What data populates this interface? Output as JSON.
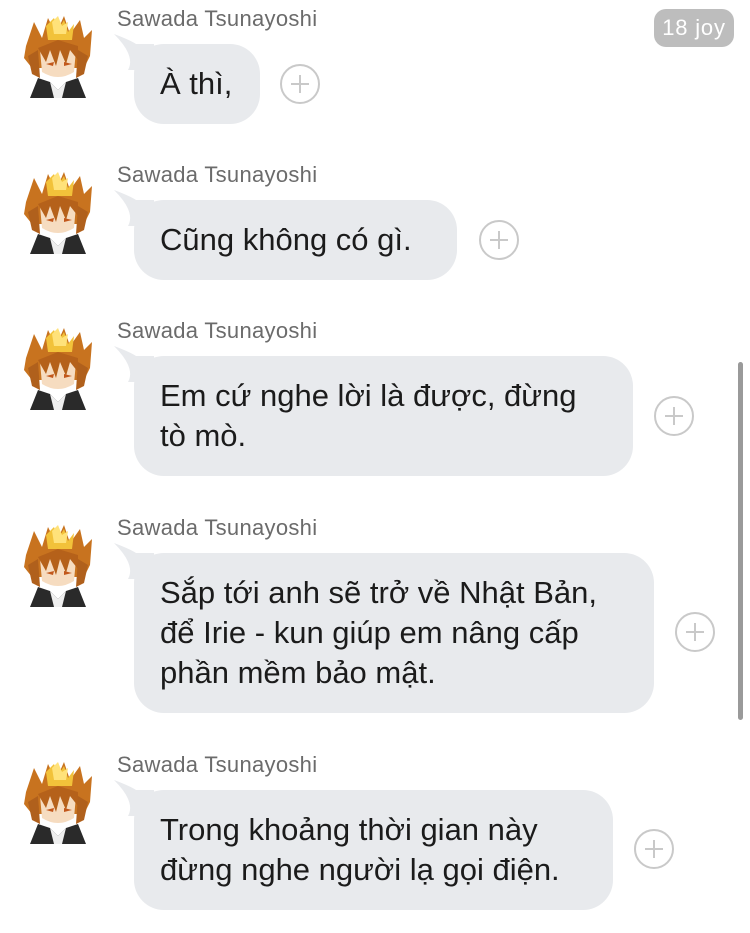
{
  "time_badge": "18 joy",
  "messages": [
    {
      "sender": "Sawada Tsunayoshi",
      "text": "À thì,"
    },
    {
      "sender": "Sawada Tsunayoshi",
      "text": "Cũng không có gì."
    },
    {
      "sender": "Sawada Tsunayoshi",
      "text": "Em cứ nghe lời là được, đừng\ntò mò."
    },
    {
      "sender": "Sawada Tsunayoshi",
      "text": "Sắp tới anh sẽ trở về Nhật Bản,\nđể Irie - kun giúp em nâng cấp\nphần mềm bảo mật."
    },
    {
      "sender": "Sawada Tsunayoshi",
      "text": "Trong khoảng thời gian này\nđừng nghe người lạ gọi điện."
    }
  ],
  "icons": {
    "avatar": "anime-avatar",
    "add": "plus-circle-icon"
  },
  "colors": {
    "bubble": "#e8eaed",
    "badge": "#bdbdbd",
    "sender": "#6b6b6b",
    "add_button_border": "#c9c9c9"
  }
}
